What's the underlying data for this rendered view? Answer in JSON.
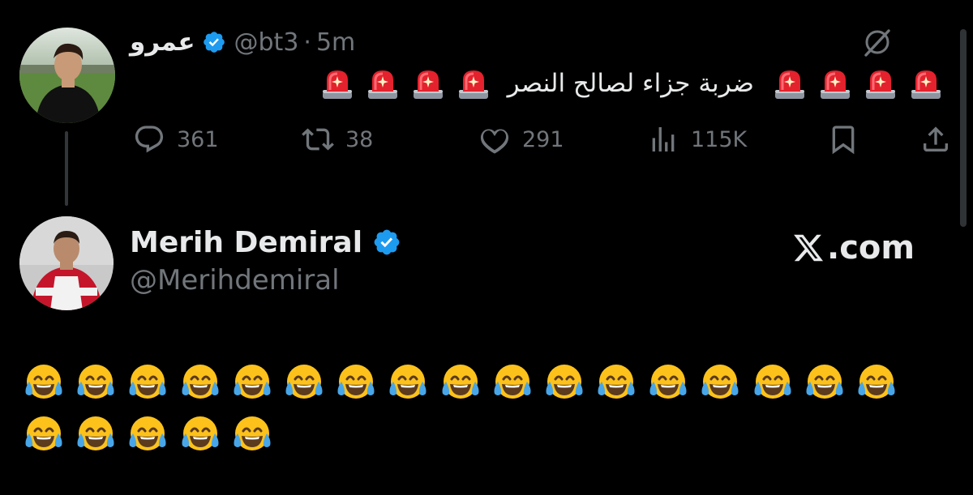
{
  "tweet": {
    "author_name": "عمرو",
    "handle": "@bt3",
    "time": "5m",
    "separator": "·",
    "text": "ضربة جزاء لصالح النصر",
    "emoji_before_count": 4,
    "emoji_after_count": 4,
    "actions": {
      "replies": "361",
      "retweets": "38",
      "likes": "291",
      "views": "115K"
    },
    "icons": [
      "verified-badge-icon",
      "grok-icon",
      "reply-icon",
      "retweet-icon",
      "like-icon",
      "views-icon",
      "bookmark-icon",
      "share-icon",
      "siren-emoji"
    ]
  },
  "quoted": {
    "author_name": "Merih Demiral",
    "handle": "@Merihdemiral",
    "brand": ".com",
    "brand_icon": "x-logo-icon",
    "emoji": "😂",
    "emoji_rows": [
      17,
      5
    ]
  },
  "colors": {
    "background": "#000000",
    "text": "#e7e9ea",
    "muted": "#71767b",
    "verified": "#1d9bf0"
  }
}
